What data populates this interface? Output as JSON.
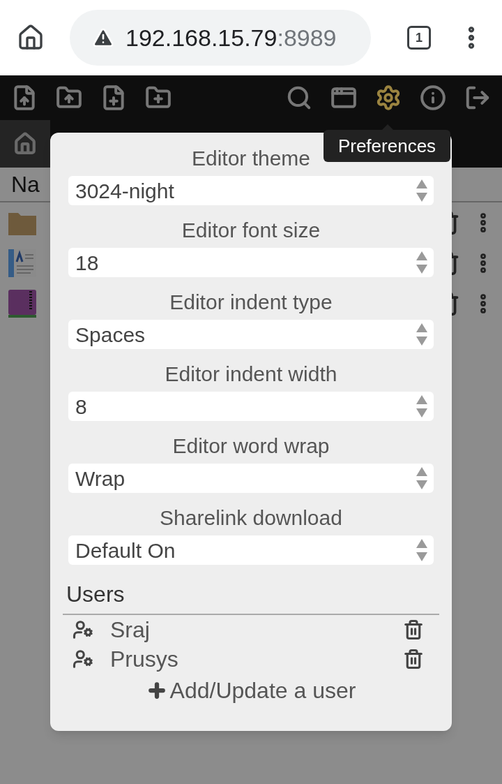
{
  "browser": {
    "host": "192.168.15.79",
    "port": ":8989",
    "tab_count": "1"
  },
  "toolbar": [
    {
      "kind": "upload-file",
      "selected": false
    },
    {
      "kind": "upload-folder",
      "selected": false
    },
    {
      "kind": "new-file",
      "selected": false
    },
    {
      "kind": "new-folder",
      "selected": false
    },
    {
      "kind": "search",
      "selected": false
    },
    {
      "kind": "window",
      "selected": false
    },
    {
      "kind": "settings",
      "selected": true
    },
    {
      "kind": "info",
      "selected": false
    },
    {
      "kind": "logout",
      "selected": false
    }
  ],
  "tooltip": "Preferences",
  "file_list": {
    "heading": "Na",
    "rows": [
      {
        "kind": "folder"
      },
      {
        "kind": "document"
      },
      {
        "kind": "archive"
      }
    ]
  },
  "preferences": {
    "settings": [
      {
        "label": "Editor theme",
        "value": "3024-night"
      },
      {
        "label": "Editor font size",
        "value": "18"
      },
      {
        "label": "Editor indent type",
        "value": "Spaces"
      },
      {
        "label": "Editor indent width",
        "value": "8"
      },
      {
        "label": "Editor word wrap",
        "value": "Wrap"
      },
      {
        "label": "Sharelink download",
        "value": "Default On"
      }
    ],
    "users_heading": "Users",
    "users": [
      {
        "name": "Sraj"
      },
      {
        "name": "Prusys"
      }
    ],
    "add_user": "Add/Update a user"
  }
}
